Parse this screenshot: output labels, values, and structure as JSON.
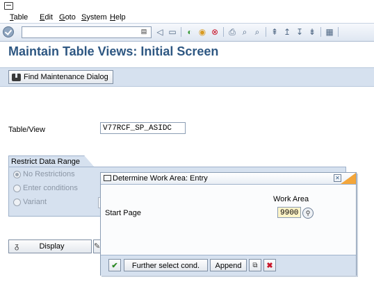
{
  "menubar": {
    "items": [
      "Table",
      "Edit",
      "Goto",
      "System",
      "Help"
    ]
  },
  "toolbar": {
    "command_value": "",
    "icons": [
      "back-icon",
      "save-icon",
      "green-back-icon",
      "exit-icon",
      "cancel-icon",
      "print-icon",
      "find-icon",
      "find-next-icon",
      "first-page-icon",
      "prev-page-icon",
      "next-page-icon",
      "last-page-icon",
      "layout-icon"
    ]
  },
  "page": {
    "title": "Maintain Table Views: Initial Screen"
  },
  "app_toolbar": {
    "find_button": "Find Maintenance Dialog"
  },
  "form": {
    "tableview_label": "Table/View",
    "tableview_value": "V77RCF_SP_ASIDC",
    "restrict_title": "Restrict Data Range",
    "options": [
      "No Restrictions",
      "Enter conditions",
      "Variant"
    ],
    "selected_option": "No Restrictions",
    "display_button": "Display"
  },
  "dialog": {
    "title": "Determine Work Area: Entry",
    "work_area_label": "Work Area",
    "start_page_label": "Start Page",
    "start_page_value": "9900",
    "buttons": {
      "further": "Further select cond.",
      "append": "Append"
    }
  }
}
